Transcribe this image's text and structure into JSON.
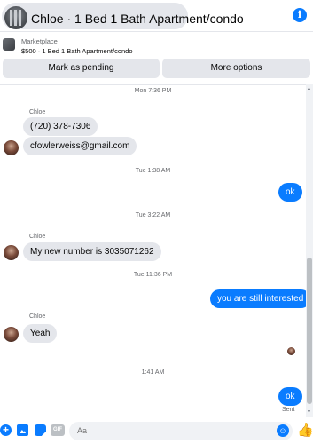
{
  "header": {
    "title": "Chloe · 1 Bed 1 Bath Apartment/condo",
    "info_glyph": "i"
  },
  "listing": {
    "label": "Marketplace",
    "price_title": "$500 · 1 Bed 1 Bath Apartment/condo",
    "pending_label": "Mark as pending",
    "more_label": "More options"
  },
  "thread": {
    "ts1": "Mon 7:36 PM",
    "sender1": "Chloe",
    "msg_phone": "(720) 378-7306",
    "msg_email": "cfowlerweiss@gmail.com",
    "ts2": "Tue 1:38 AM",
    "out1": "ok",
    "ts3": "Tue 3:22 AM",
    "sender2": "Chloe",
    "msg_number": "My new number is 3035071262",
    "ts4": "Tue 11:36 PM",
    "out2": "you are still interested",
    "sender3": "Chloe",
    "msg_yeah": "Yeah",
    "ts5": "1:41 AM",
    "out3": "ok",
    "sent_status": "Sent"
  },
  "composer": {
    "placeholder": "Aa",
    "plus_glyph": "+",
    "gif_label": "GIF",
    "emoji_glyph": "☺",
    "like_glyph": "👍"
  },
  "icons": {
    "header_avatar": "avatar-icon",
    "info": "info-icon",
    "plus": "plus-icon",
    "photo": "photo-icon",
    "sticker": "sticker-icon",
    "gif": "gif-icon",
    "emoji": "emoji-icon",
    "like": "thumbs-up-icon"
  },
  "colors": {
    "accent": "#0a7cff",
    "bubble_in": "#e4e6eb",
    "muted_text": "#65676b"
  }
}
